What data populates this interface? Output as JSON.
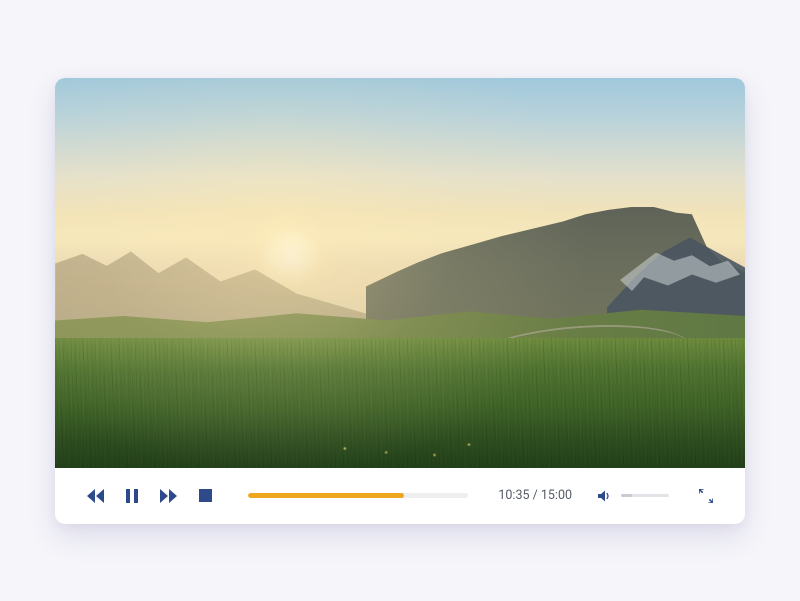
{
  "player": {
    "time_display": "10:35 / 15:00",
    "current_seconds": 635,
    "duration_seconds": 900,
    "seek_percent": 70.6,
    "volume_percent": 22,
    "icons": {
      "rewind": "rewind-icon",
      "pause": "pause-icon",
      "forward": "fast-forward-icon",
      "stop": "stop-icon",
      "volume": "volume-icon",
      "fullscreen": "fullscreen-icon"
    },
    "colors": {
      "control": "#2e4a8a",
      "seek_fill": "#f0a720",
      "seek_track": "#eceef0"
    }
  }
}
